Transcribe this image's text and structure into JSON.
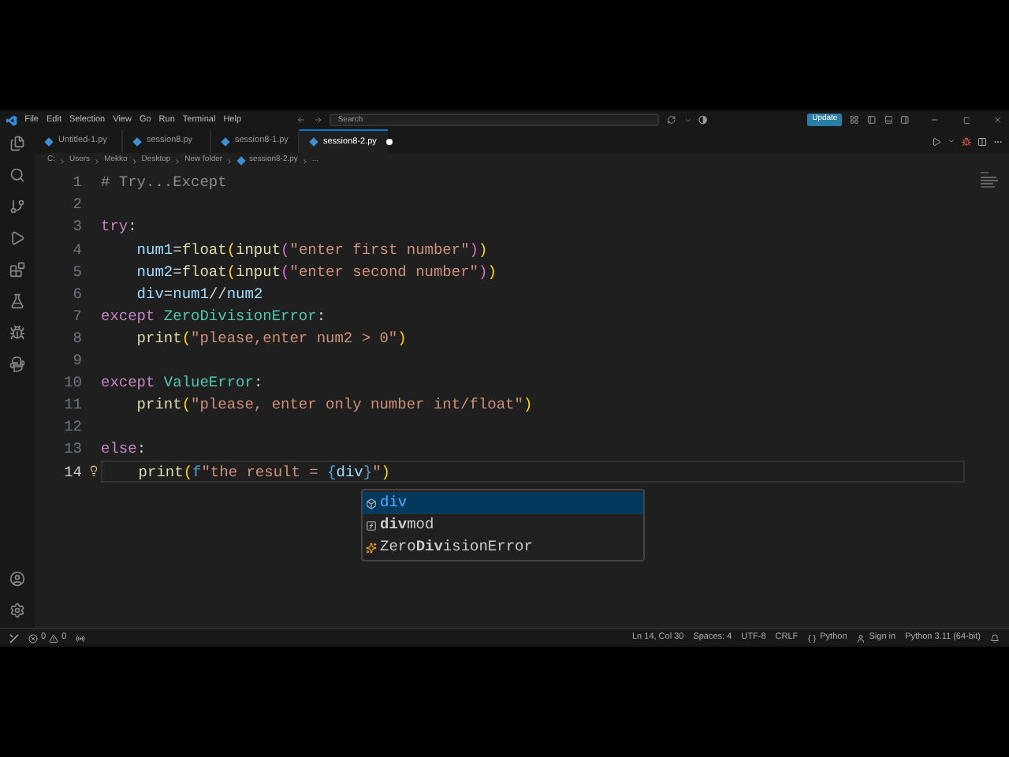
{
  "menu": [
    "File",
    "Edit",
    "Selection",
    "View",
    "Go",
    "Run",
    "Terminal",
    "Help"
  ],
  "search": {
    "placeholder": "Search"
  },
  "update_button": "Update",
  "tabs": [
    {
      "label": "Untitled-1.py",
      "selected": false,
      "modified": false
    },
    {
      "label": "session8.py",
      "selected": false,
      "modified": false
    },
    {
      "label": "session8-1.py",
      "selected": false,
      "modified": false
    },
    {
      "label": "session8-2.py",
      "selected": true,
      "modified": true
    }
  ],
  "breadcrumb": [
    {
      "label": "C:",
      "kind": "text"
    },
    {
      "label": "Users",
      "kind": "text"
    },
    {
      "label": "Mekko",
      "kind": "text"
    },
    {
      "label": "Desktop",
      "kind": "text"
    },
    {
      "label": "New folder",
      "kind": "text"
    },
    {
      "label": "session8-2.py",
      "kind": "file"
    },
    {
      "label": "...",
      "kind": "text"
    }
  ],
  "lines": [
    {
      "number": "1",
      "current": false,
      "lightbulb": false,
      "tokens": [
        {
          "text": "# Try...Except",
          "color": "#8a8a8a"
        }
      ]
    },
    {
      "number": "2",
      "current": false,
      "lightbulb": false
    },
    {
      "number": "3",
      "current": false,
      "lightbulb": false,
      "tokens": [
        {
          "text": "try",
          "color": "#c586c0"
        },
        {
          "text": ":",
          "color": "#d4d4d4"
        }
      ]
    },
    {
      "number": "4",
      "current": false,
      "lightbulb": false,
      "tokens": [
        {
          "text": "    num1",
          "color": "#9cdcfe"
        },
        {
          "text": "=",
          "color": "#d4d4d4"
        },
        {
          "text": "float",
          "color": "#dcdcaa"
        },
        {
          "text": "(",
          "color": "#ffd700"
        },
        {
          "text": "input",
          "color": "#dcdcaa"
        },
        {
          "text": "(",
          "color": "#da70d6"
        },
        {
          "text": "\"enter first number\"",
          "color": "#ce9178"
        },
        {
          "text": ")",
          "color": "#da70d6"
        },
        {
          "text": ")",
          "color": "#ffd700"
        }
      ]
    },
    {
      "number": "5",
      "current": false,
      "lightbulb": false,
      "tokens": [
        {
          "text": "    num2",
          "color": "#9cdcfe"
        },
        {
          "text": "=",
          "color": "#d4d4d4"
        },
        {
          "text": "float",
          "color": "#dcdcaa"
        },
        {
          "text": "(",
          "color": "#ffd700"
        },
        {
          "text": "input",
          "color": "#dcdcaa"
        },
        {
          "text": "(",
          "color": "#da70d6"
        },
        {
          "text": "\"enter second number\"",
          "color": "#ce9178"
        },
        {
          "text": ")",
          "color": "#da70d6"
        },
        {
          "text": ")",
          "color": "#ffd700"
        }
      ]
    },
    {
      "number": "6",
      "current": false,
      "lightbulb": false,
      "tokens": [
        {
          "text": "    div",
          "color": "#9cdcfe"
        },
        {
          "text": "=",
          "color": "#d4d4d4"
        },
        {
          "text": "num1",
          "color": "#9cdcfe"
        },
        {
          "text": "//",
          "color": "#d4d4d4"
        },
        {
          "text": "num2",
          "color": "#9cdcfe"
        }
      ]
    },
    {
      "number": "7",
      "current": false,
      "lightbulb": false,
      "tokens": [
        {
          "text": "except ",
          "color": "#c586c0"
        },
        {
          "text": "ZeroDivisionError",
          "color": "#4ec9b0"
        },
        {
          "text": ":",
          "color": "#d4d4d4"
        }
      ]
    },
    {
      "number": "8",
      "current": false,
      "lightbulb": false,
      "tokens": [
        {
          "text": "    print",
          "color": "#dcdcaa"
        },
        {
          "text": "(",
          "color": "#ffd700"
        },
        {
          "text": "\"please,enter num2 > 0\"",
          "color": "#ce9178"
        },
        {
          "text": ")",
          "color": "#ffd700"
        }
      ]
    },
    {
      "number": "9",
      "current": false,
      "lightbulb": false
    },
    {
      "number": "10",
      "current": false,
      "lightbulb": false,
      "tokens": [
        {
          "text": "except ",
          "color": "#c586c0"
        },
        {
          "text": "ValueError",
          "color": "#4ec9b0"
        },
        {
          "text": ":",
          "color": "#d4d4d4"
        }
      ]
    },
    {
      "number": "11",
      "current": false,
      "lightbulb": false,
      "tokens": [
        {
          "text": "    print",
          "color": "#dcdcaa"
        },
        {
          "text": "(",
          "color": "#ffd700"
        },
        {
          "text": "\"please, enter only number int/float\"",
          "color": "#ce9178"
        },
        {
          "text": ")",
          "color": "#ffd700"
        }
      ]
    },
    {
      "number": "12",
      "current": false,
      "lightbulb": false
    },
    {
      "number": "13",
      "current": false,
      "lightbulb": false,
      "tokens": [
        {
          "text": "else",
          "color": "#c586c0"
        },
        {
          "text": ":",
          "color": "#d4d4d4"
        }
      ]
    },
    {
      "number": "14",
      "current": true,
      "lightbulb": true,
      "tokens": [
        {
          "text": "    print",
          "color": "#dcdcaa"
        },
        {
          "text": "(",
          "color": "#ffd700"
        },
        {
          "text": "f",
          "color": "#569cd6"
        },
        {
          "text": "\"the result = ",
          "color": "#ce9178"
        },
        {
          "text": "{",
          "color": "#569cd6"
        },
        {
          "text": "div",
          "color": "#9cdcfe"
        },
        {
          "text": "}",
          "color": "#569cd6"
        },
        {
          "text": "\"",
          "color": "#ce9178"
        },
        {
          "text": ")",
          "color": "#ffd700"
        }
      ]
    }
  ],
  "suggestions": [
    {
      "label": "div",
      "kind": "variable",
      "selected": true
    },
    {
      "label": "**div**mod",
      "kind": "function",
      "selected": false
    },
    {
      "label": "Zero**Div**isionError",
      "kind": "class",
      "selected": false
    }
  ],
  "status_bar": {
    "errors": "0",
    "warnings": "0",
    "position": "Ln 14, Col 30",
    "spaces": "Spaces: 4",
    "encoding": "UTF-8",
    "eol": "CRLF",
    "language": "Python",
    "account": "Sign in",
    "interpreter": "Python 3.11 (64-bit)"
  }
}
